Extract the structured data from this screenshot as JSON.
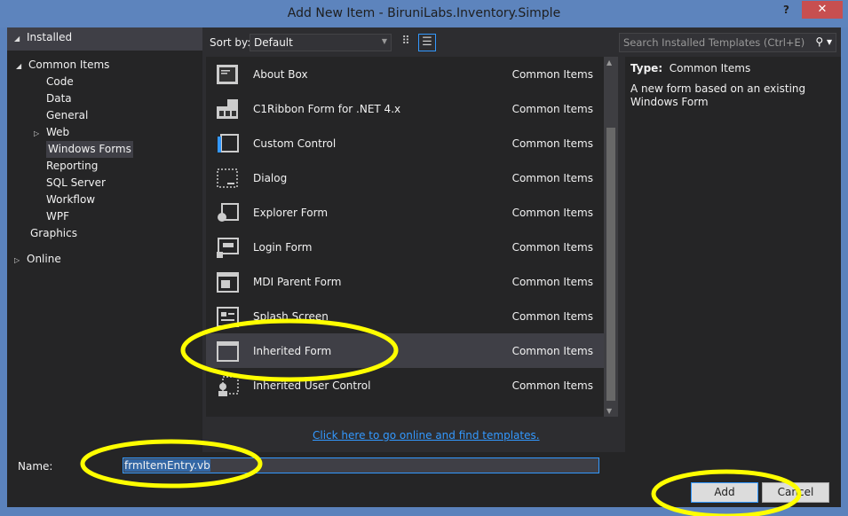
{
  "window": {
    "title": "Add New Item - BiruniLabs.Inventory.Simple",
    "help": "?",
    "close": "✕"
  },
  "sidebar": {
    "header": "Installed",
    "common": "Common Items",
    "children": [
      "Code",
      "Data",
      "General",
      "Web",
      "Windows Forms",
      "Reporting",
      "SQL Server",
      "Workflow",
      "WPF"
    ],
    "selected": "Windows Forms",
    "graphics": "Graphics",
    "online": "Online"
  },
  "toolbar": {
    "sort_label": "Sort by:",
    "sort_value": "Default",
    "search_placeholder": "Search Installed Templates (Ctrl+E)"
  },
  "items": [
    {
      "name": "About Box",
      "category": "Common Items",
      "icon": "about-box-icon"
    },
    {
      "name": "C1Ribbon Form for .NET 4.x",
      "category": "Common Items",
      "icon": "ribbon-form-icon"
    },
    {
      "name": "Custom Control",
      "category": "Common Items",
      "icon": "custom-control-icon"
    },
    {
      "name": "Dialog",
      "category": "Common Items",
      "icon": "dialog-icon"
    },
    {
      "name": "Explorer Form",
      "category": "Common Items",
      "icon": "explorer-form-icon"
    },
    {
      "name": "Login Form",
      "category": "Common Items",
      "icon": "login-form-icon"
    },
    {
      "name": "MDI Parent Form",
      "category": "Common Items",
      "icon": "mdi-form-icon"
    },
    {
      "name": "Splash Screen",
      "category": "Common Items",
      "icon": "splash-screen-icon"
    },
    {
      "name": "Inherited Form",
      "category": "Common Items",
      "icon": "inherited-form-icon",
      "selected": true
    },
    {
      "name": "Inherited User Control",
      "category": "Common Items",
      "icon": "inherited-control-icon"
    }
  ],
  "details": {
    "type_label": "Type:",
    "type_value": "Common Items",
    "description": "A new form based on an existing Windows Form"
  },
  "online_link": "Click here to go online and find templates.",
  "footer": {
    "name_label": "Name:",
    "name_value": "frmItemEntry.vb",
    "add": "Add",
    "cancel": "Cancel"
  },
  "colors": {
    "accent": "#3399ff",
    "titlebar": "#5d84bd",
    "close": "#c74f50",
    "annotation": "#ffff00"
  }
}
